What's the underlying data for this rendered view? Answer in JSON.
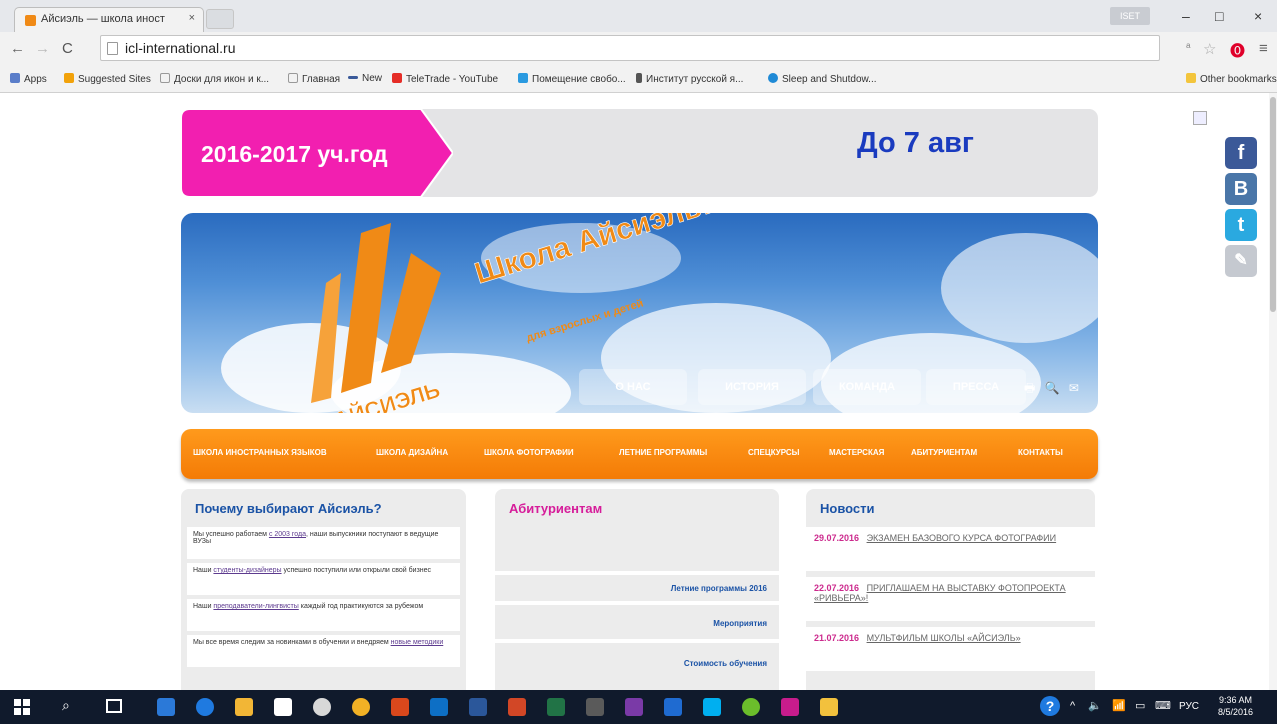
{
  "browser": {
    "tab_title": "Айсиэль — школа иност... ×",
    "tab_title_text": "Айсиэль — школа иност",
    "tab_close": "×",
    "user_badge": "ISET",
    "url": "icl-international.ru",
    "window_controls": {
      "minimize": "–",
      "maximize": "□",
      "close": "×"
    },
    "bookmarks": [
      {
        "label": "Apps",
        "icon": "apps-grid-icon",
        "color": "#5a7dc9"
      },
      {
        "label": "Suggested Sites",
        "icon": "suggested-sites-icon",
        "color": "#f2a20a"
      },
      {
        "label": "Доски для икон и к...",
        "icon": "page-icon",
        "color": "#ffffff"
      },
      {
        "label": "Главная",
        "icon": "page-icon",
        "color": "#ffffff"
      },
      {
        "label": "New",
        "icon": "dash-icon",
        "color": "#3a5a9a"
      },
      {
        "label": "TeleTrade - YouTube",
        "icon": "youtube-icon",
        "color": "#e52d27"
      },
      {
        "label": "Помещение свобо...",
        "icon": "site-icon",
        "color": "#2a9ae0"
      },
      {
        "label": "Институт русской я...",
        "icon": "book-icon",
        "color": "#555555"
      },
      {
        "label": "Sleep and Shutdow...",
        "icon": "globe-icon",
        "color": "#1f8ad6"
      }
    ],
    "other_bookmarks": "Other bookmarks"
  },
  "banner": {
    "year": "2016-2017 уч.год",
    "deadline": "До 7 авг",
    "badge_color": "#f21fb0"
  },
  "hero": {
    "title": "Школа Айсиэль!",
    "subtitle": "для взрослых и детей",
    "brand": "АЙСИЭЛЬ",
    "nav": [
      "О НАС",
      "ИСТОРИЯ",
      "КОМАНДА",
      "ПРЕССА"
    ],
    "icons": "🖶 🔍 ✉"
  },
  "menu": {
    "items": [
      "ШКОЛА ИНОСТРАННЫХ ЯЗЫКОВ",
      "ШКОЛА ДИЗАЙНА",
      "ШКОЛА ФОТОГРАФИИ",
      "ЛЕТНИЕ ПРОГРАММЫ",
      "СПЕЦКУРСЫ",
      "МАСТЕРСКАЯ",
      "АБИТУРИЕНТАМ",
      "КОНТАКТЫ"
    ],
    "color": "#f47b06"
  },
  "why": {
    "title": "Почему выбирают Айсиэль?",
    "items": [
      {
        "pre": "Мы успешно работаем ",
        "link": "с 2003 года",
        "post": ", наши выпускники поступают в ведущие ВУЗы"
      },
      {
        "pre": "Наши ",
        "link": "студенты-дизайнеры",
        "post": " успешно поступили или открыли свой бизнес"
      },
      {
        "pre": "Наши ",
        "link": "преподаватели-лингвисты",
        "post": " каждый год практикуются за рубежом"
      },
      {
        "pre": "Мы все время следим за новинками в обучении и внедряем ",
        "link": "новые методики",
        "post": ""
      }
    ]
  },
  "abiturients": {
    "title": "Абитуриентам",
    "items": [
      "Летние программы 2016",
      "Мероприятия",
      "Стоимость обучения"
    ]
  },
  "news": {
    "title": "Новости",
    "items": [
      {
        "date": "29.07.2016",
        "title": "ЭКЗАМЕН БАЗОВОГО КУРСА ФОТОГРАФИИ"
      },
      {
        "date": "22.07.2016",
        "title": "ПРИГЛАШАЕМ НА ВЫСТАВКУ ФОТОПРОЕКТА «РИВЬЕРА»!"
      },
      {
        "date": "21.07.2016",
        "title": "МУЛЬТФИЛЬМ ШКОЛЫ «АЙСИЭЛЬ»"
      }
    ]
  },
  "social": [
    {
      "label": "f",
      "icon": "facebook-icon",
      "color": "#3b5998"
    },
    {
      "label": "В",
      "icon": "vkontakte-icon",
      "color": "#4a76a8"
    },
    {
      "label": "t",
      "icon": "twitter-icon",
      "color": "#2aa9e0"
    },
    {
      "label": "✎",
      "icon": "livejournal-icon",
      "color": "#c5c9d0"
    }
  ],
  "taskbar": {
    "lang": "РУС",
    "time": "9:36 AM",
    "date": "8/5/2016",
    "apps": [
      {
        "icon": "file-explorer-icon",
        "color": "#2b79d8"
      },
      {
        "icon": "edge-icon",
        "color": "#1f7ae0"
      },
      {
        "icon": "folder-icon",
        "color": "#f2b636"
      },
      {
        "icon": "store-icon",
        "color": "#ffffff"
      },
      {
        "icon": "chrome-icon",
        "color": "#f2b125"
      },
      {
        "icon": "outlook-icon",
        "color": "#0d6fc5"
      },
      {
        "icon": "mail-icon",
        "color": "#d9481c"
      },
      {
        "icon": "word-icon",
        "color": "#2b579a"
      },
      {
        "icon": "powerpoint-icon",
        "color": "#d24726"
      },
      {
        "icon": "excel-icon",
        "color": "#217346"
      },
      {
        "icon": "calculator-icon",
        "color": "#5a5a5a"
      },
      {
        "icon": "onenote-icon",
        "color": "#7a3aa7"
      },
      {
        "icon": "photos-icon",
        "color": "#1f6bd1"
      },
      {
        "icon": "skype-icon",
        "color": "#00aff0"
      },
      {
        "icon": "game-icon",
        "color": "#6bbd2b"
      },
      {
        "icon": "media-icon",
        "color": "#c81c8c"
      },
      {
        "icon": "explorer-icon",
        "color": "#f2c13d"
      }
    ]
  }
}
